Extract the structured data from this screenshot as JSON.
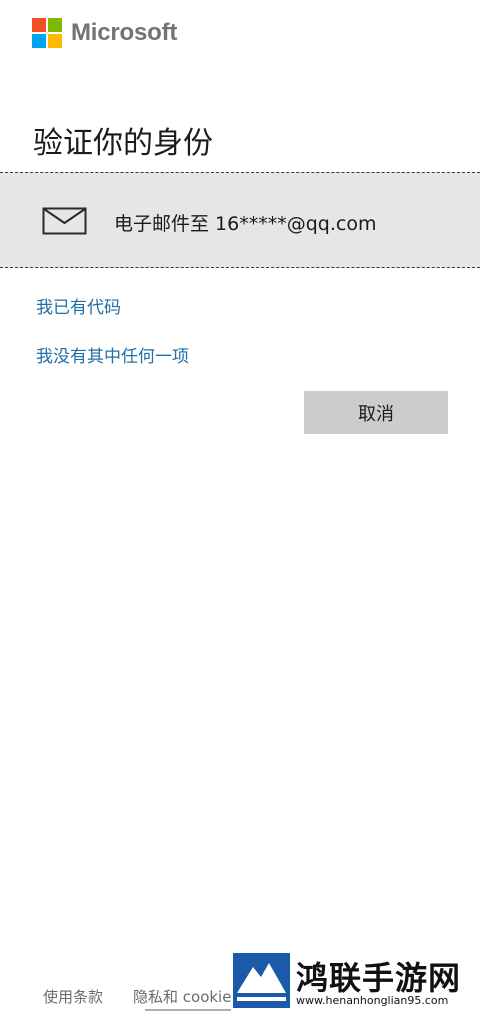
{
  "brand": {
    "name": "Microsoft",
    "colors": {
      "red": "#f25022",
      "green": "#7fba00",
      "blue": "#00a4ef",
      "yellow": "#ffb900"
    }
  },
  "page": {
    "title": "验证你的身份"
  },
  "verify_option": {
    "icon": "mail-icon",
    "label": "电子邮件至 16*****@qq.com"
  },
  "links": {
    "have_code": "我已有代码",
    "none_of_these": "我没有其中任何一项"
  },
  "buttons": {
    "cancel": "取消"
  },
  "footer": {
    "terms": "使用条款",
    "privacy": "隐私和 cookie"
  },
  "watermark": {
    "title": "鸿联手游网",
    "url": "www.henanhonglian95.com"
  },
  "accent_colors": {
    "link": "#1f6fa8",
    "option_bg": "#e6e6e6",
    "button_bg": "#cccccc"
  }
}
